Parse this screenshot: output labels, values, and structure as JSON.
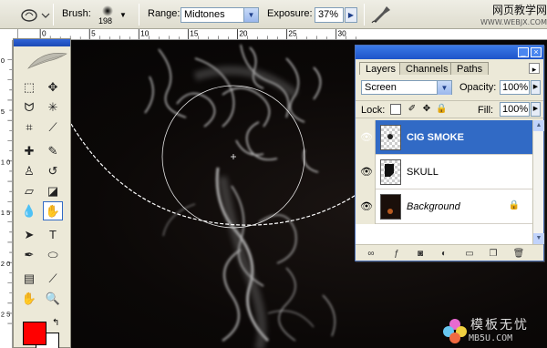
{
  "options_bar": {
    "brush_label": "Brush:",
    "brush_size": "198",
    "range_label": "Range:",
    "range_value": "Midtones",
    "exposure_label": "Exposure:",
    "exposure_value": "37%"
  },
  "watermark": {
    "top_title": "网页教学网",
    "top_url": "WWW.WEBJX.COM",
    "bottom_cn": "模板无忧",
    "bottom_domain": "MB5U.COM"
  },
  "rulers": {
    "top_ticks": [
      "0",
      "5",
      "10",
      "15",
      "20",
      "25",
      "30"
    ],
    "left_ticks": [
      "0",
      "5",
      "1 0",
      "1 5",
      "2 0",
      "2 5"
    ]
  },
  "layers_panel": {
    "tabs": [
      "Layers",
      "Channels",
      "Paths"
    ],
    "active_tab": "Layers",
    "blend_mode": "Screen",
    "opacity_label": "Opacity:",
    "opacity_value": "100%",
    "lock_label": "Lock:",
    "fill_label": "Fill:",
    "fill_value": "100%",
    "layers": [
      {
        "name": "CIG SMOKE",
        "selected": true
      },
      {
        "name": "SKULL",
        "selected": false
      },
      {
        "name": "Background",
        "selected": false,
        "locked": true
      }
    ]
  },
  "colors": {
    "foreground": "#ff0000",
    "background": "#ffffff",
    "selection": "#316ac5",
    "titlebar": "#1e54c9"
  },
  "active_tool": "burn-tool"
}
